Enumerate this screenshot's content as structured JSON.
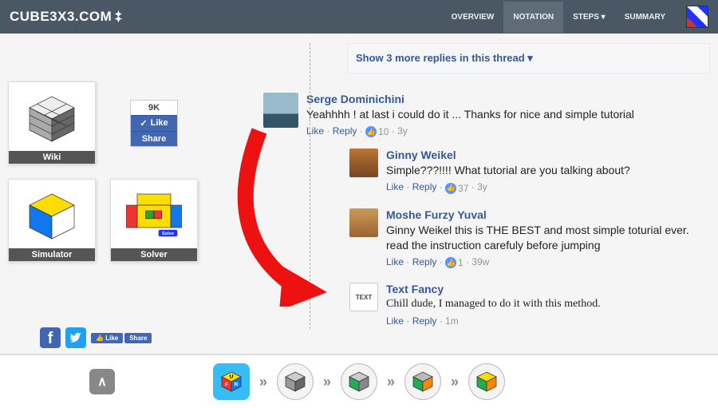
{
  "nav": {
    "logo": "CUBE3X3.COM",
    "links": [
      "OVERVIEW",
      "NOTATION",
      "STEPS",
      "SUMMARY"
    ],
    "activeIndex": 1
  },
  "sidebar": {
    "tiles": [
      {
        "label": "Wiki"
      },
      {
        "label": "Simulator"
      },
      {
        "label": "Solver"
      }
    ],
    "fb": {
      "count": "9K",
      "like": "Like",
      "share": "Share"
    },
    "miniLike": "Like",
    "miniShare": "Share"
  },
  "thread": {
    "moreReplies": "Show 3 more replies in this thread",
    "comments": [
      {
        "name": "Serge Dominichini",
        "text": "Yeahhhh ! at last i could do it ... Thanks for nice and simple tutorial",
        "like": "Like",
        "reply": "Reply",
        "count": "10",
        "age": "3y",
        "replies": [
          {
            "name": "Ginny Weikel",
            "text": "Simple???!!!! What tutorial are you talking about?",
            "like": "Like",
            "reply": "Reply",
            "count": "37",
            "age": "3y"
          },
          {
            "name": "Moshe Furzy Yuval",
            "text": "Ginny Weikel this is THE BEST and most simple toturial ever. read the instruction carefuly before jumping",
            "like": "Like",
            "reply": "Reply",
            "count": "1",
            "age": "39w"
          },
          {
            "name": "Text Fancy",
            "text": "Chill dude, I managed to do it with this method.",
            "like": "Like",
            "reply": "Reply",
            "age": "1m",
            "fancy": true
          }
        ]
      }
    ]
  }
}
